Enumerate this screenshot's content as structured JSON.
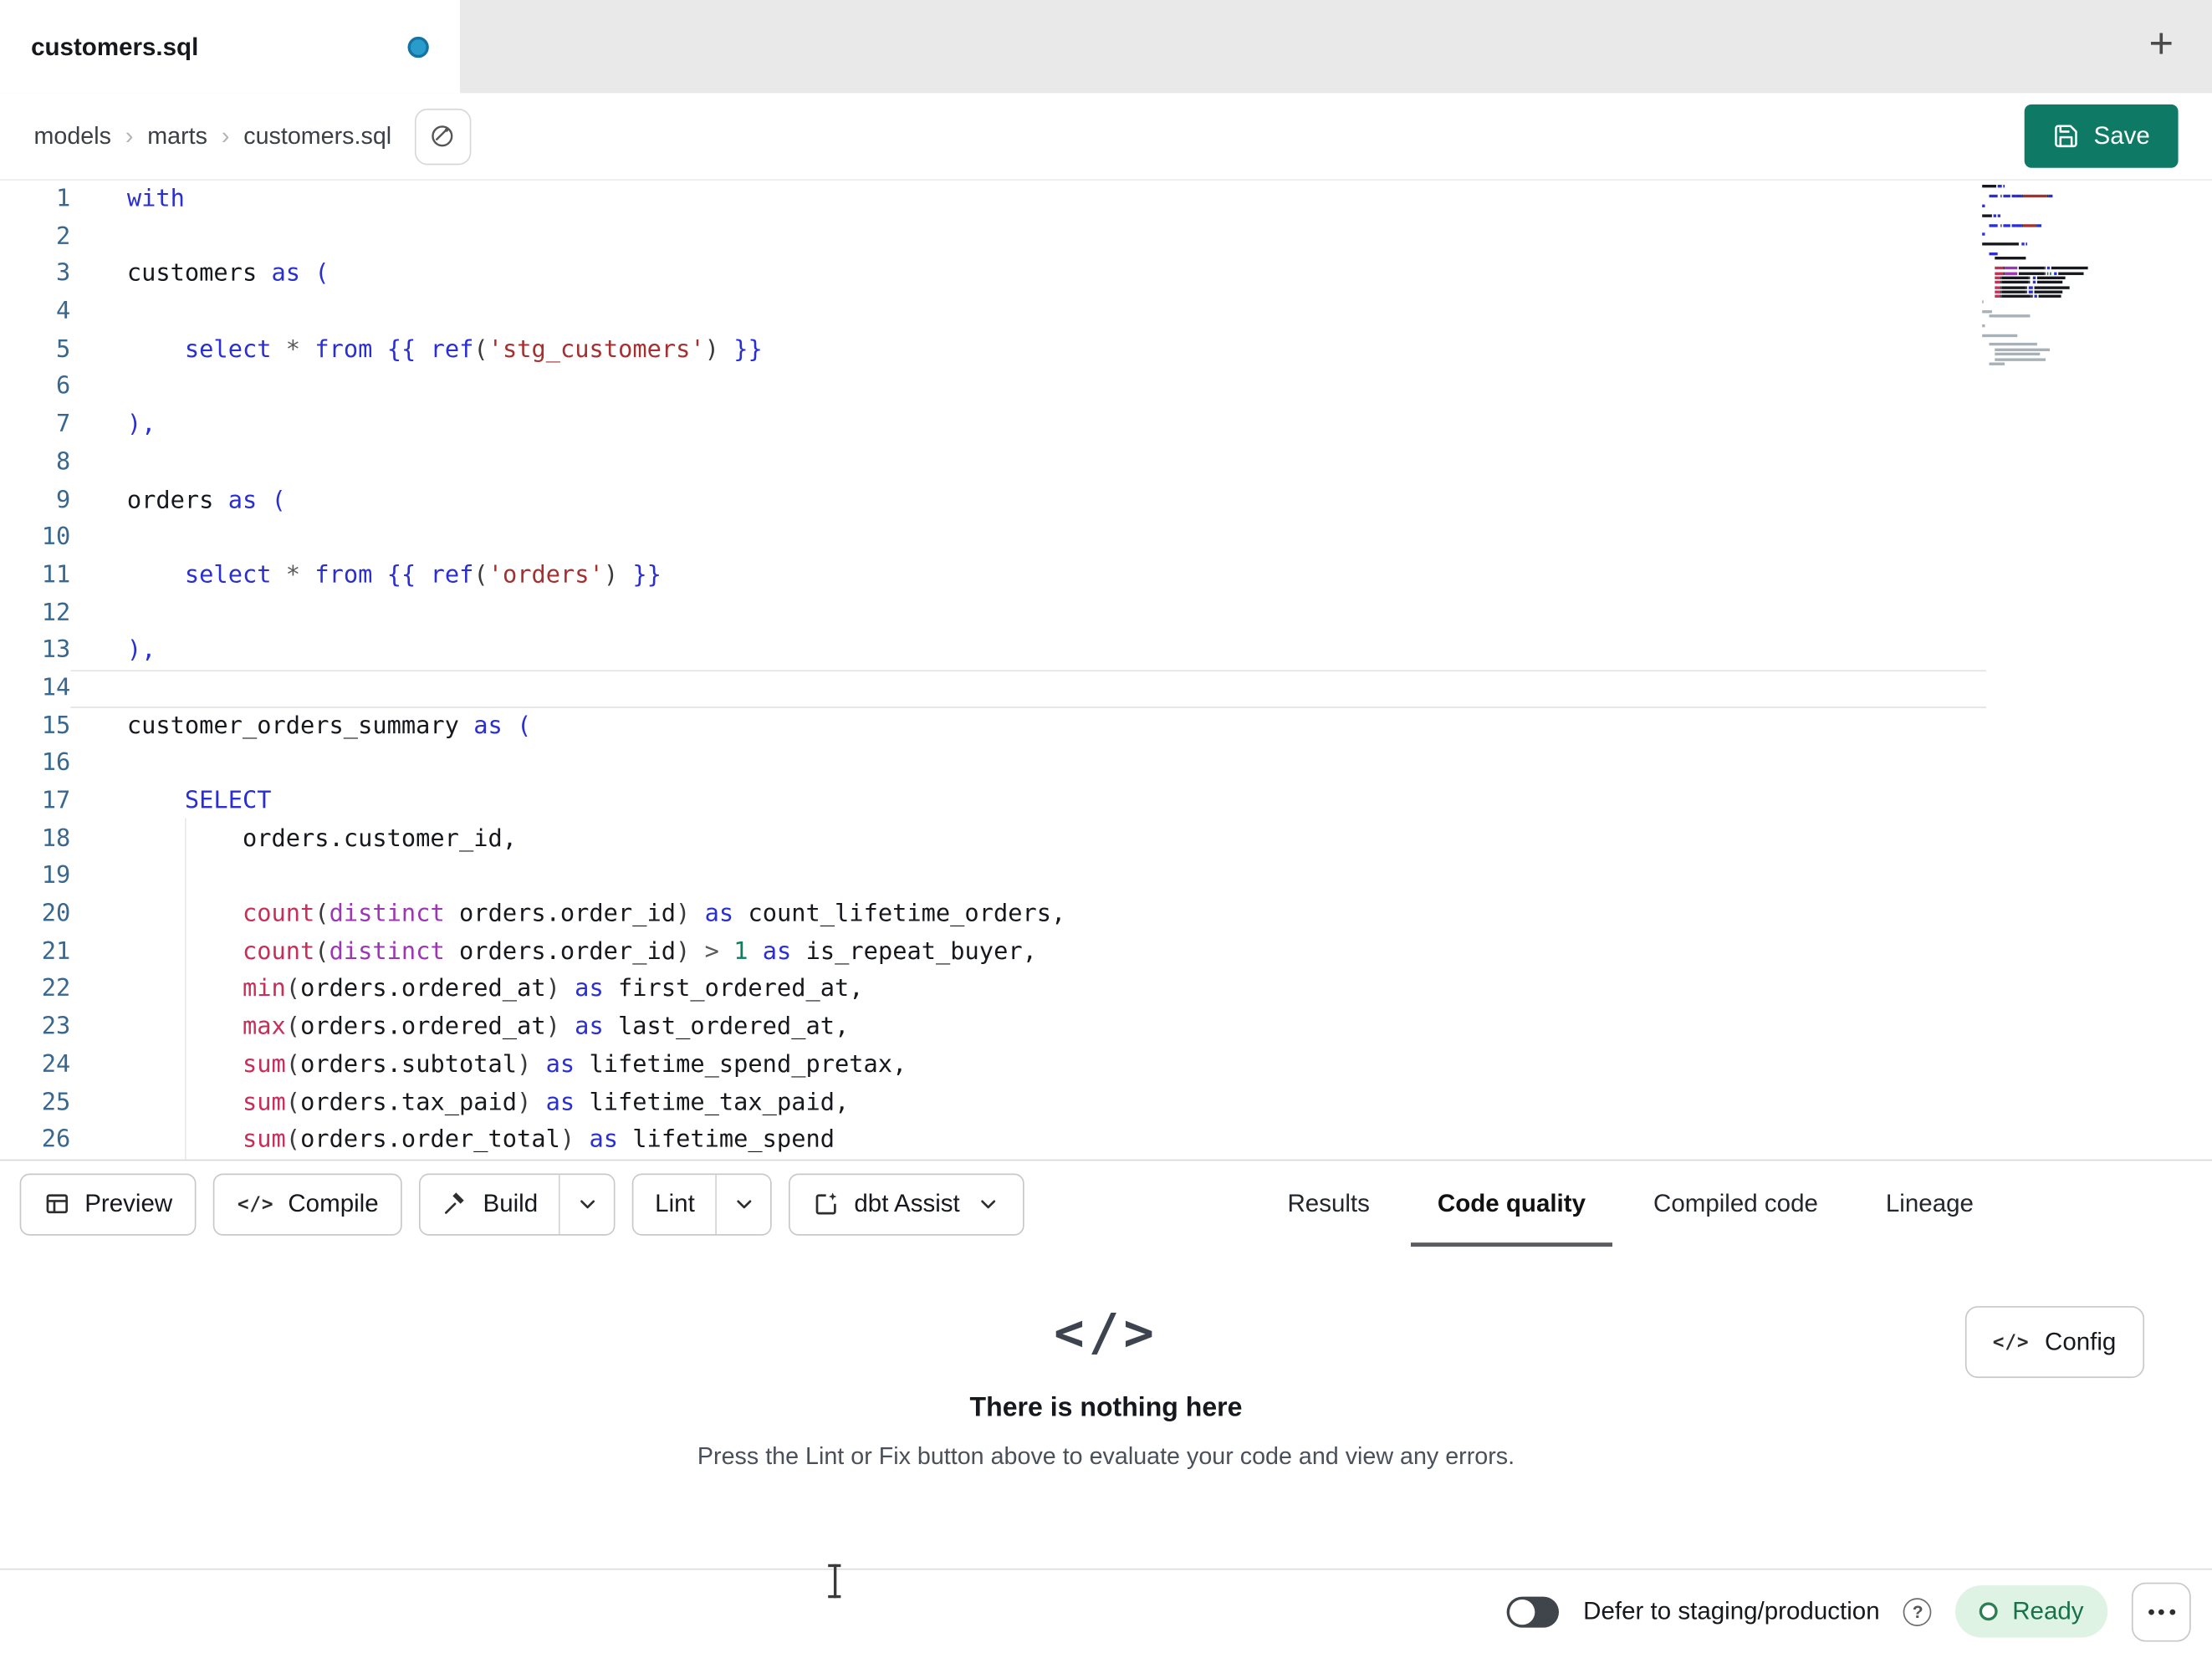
{
  "tabbar": {
    "file_tab": {
      "title": "customers.sql"
    }
  },
  "icons": {
    "code_slash": "</>",
    "new_tab": "+",
    "help": "?",
    "breadcrumb_sep": "›"
  },
  "breadcrumb": {
    "items": [
      "models",
      "marts",
      "customers.sql"
    ]
  },
  "save_button": {
    "label": "Save"
  },
  "editor": {
    "active_line": 14,
    "colors": {
      "kw": "#2a2fd4",
      "fn": "#c72e58",
      "str": "#a53030",
      "dst": "#9c36b5",
      "num": "#0e7d62",
      "op": "#5a5a5a",
      "pu": "#3a3a3a",
      "id": "#16181d"
    },
    "lines": [
      {
        "n": 1,
        "indent": 0,
        "t": [
          [
            "with",
            "kw"
          ]
        ]
      },
      {
        "n": 2,
        "indent": 0,
        "t": []
      },
      {
        "n": 3,
        "indent": 0,
        "t": [
          [
            "customers",
            "id"
          ],
          [
            " ",
            "id"
          ],
          [
            "as",
            "kw"
          ],
          [
            " ",
            "id"
          ],
          [
            "(",
            "kw"
          ]
        ]
      },
      {
        "n": 4,
        "indent": 0,
        "t": []
      },
      {
        "n": 5,
        "indent": 4,
        "t": [
          [
            "select",
            "kw"
          ],
          [
            " ",
            "id"
          ],
          [
            "*",
            "op"
          ],
          [
            " ",
            "id"
          ],
          [
            "from",
            "kw"
          ],
          [
            " ",
            "id"
          ],
          [
            "{{ ",
            "kw"
          ],
          [
            "ref",
            "kw"
          ],
          [
            "(",
            "pu"
          ],
          [
            "'stg_customers'",
            "str"
          ],
          [
            ")",
            "pu"
          ],
          [
            " }}",
            "kw"
          ]
        ]
      },
      {
        "n": 6,
        "indent": 0,
        "t": []
      },
      {
        "n": 7,
        "indent": 0,
        "t": [
          [
            "),",
            "kw"
          ]
        ]
      },
      {
        "n": 8,
        "indent": 0,
        "t": []
      },
      {
        "n": 9,
        "indent": 0,
        "t": [
          [
            "orders",
            "id"
          ],
          [
            " ",
            "id"
          ],
          [
            "as",
            "kw"
          ],
          [
            " ",
            "id"
          ],
          [
            "(",
            "kw"
          ]
        ]
      },
      {
        "n": 10,
        "indent": 0,
        "t": []
      },
      {
        "n": 11,
        "indent": 4,
        "t": [
          [
            "select",
            "kw"
          ],
          [
            " ",
            "id"
          ],
          [
            "*",
            "op"
          ],
          [
            " ",
            "id"
          ],
          [
            "from",
            "kw"
          ],
          [
            " ",
            "id"
          ],
          [
            "{{ ",
            "kw"
          ],
          [
            "ref",
            "kw"
          ],
          [
            "(",
            "pu"
          ],
          [
            "'orders'",
            "str"
          ],
          [
            ")",
            "pu"
          ],
          [
            " }}",
            "kw"
          ]
        ]
      },
      {
        "n": 12,
        "indent": 0,
        "t": []
      },
      {
        "n": 13,
        "indent": 0,
        "t": [
          [
            "),",
            "kw"
          ]
        ]
      },
      {
        "n": 14,
        "indent": 0,
        "t": []
      },
      {
        "n": 15,
        "indent": 0,
        "t": [
          [
            "customer_orders_summary",
            "id"
          ],
          [
            " ",
            "id"
          ],
          [
            "as",
            "kw"
          ],
          [
            " ",
            "id"
          ],
          [
            "(",
            "kw"
          ]
        ]
      },
      {
        "n": 16,
        "indent": 0,
        "t": []
      },
      {
        "n": 17,
        "indent": 4,
        "t": [
          [
            "SELECT",
            "kw"
          ]
        ]
      },
      {
        "n": 18,
        "indent": 8,
        "t": [
          [
            "orders.customer_id,",
            "id"
          ]
        ]
      },
      {
        "n": 19,
        "indent": 0,
        "t": []
      },
      {
        "n": 20,
        "indent": 8,
        "t": [
          [
            "count",
            "fn"
          ],
          [
            "(",
            "pu"
          ],
          [
            "distinct",
            "dst"
          ],
          [
            " ",
            "id"
          ],
          [
            "orders.order_id",
            "id"
          ],
          [
            ")",
            "pu"
          ],
          [
            " ",
            "id"
          ],
          [
            "as",
            "kw"
          ],
          [
            " ",
            "id"
          ],
          [
            "count_lifetime_orders,",
            "id"
          ]
        ]
      },
      {
        "n": 21,
        "indent": 8,
        "t": [
          [
            "count",
            "fn"
          ],
          [
            "(",
            "pu"
          ],
          [
            "distinct",
            "dst"
          ],
          [
            " ",
            "id"
          ],
          [
            "orders.order_id",
            "id"
          ],
          [
            ")",
            "pu"
          ],
          [
            " ",
            "id"
          ],
          [
            ">",
            "op"
          ],
          [
            " ",
            "id"
          ],
          [
            "1",
            "num"
          ],
          [
            " ",
            "id"
          ],
          [
            "as",
            "kw"
          ],
          [
            " ",
            "id"
          ],
          [
            "is_repeat_buyer,",
            "id"
          ]
        ]
      },
      {
        "n": 22,
        "indent": 8,
        "t": [
          [
            "min",
            "fn"
          ],
          [
            "(",
            "pu"
          ],
          [
            "orders.ordered_at",
            "id"
          ],
          [
            ")",
            "pu"
          ],
          [
            " ",
            "id"
          ],
          [
            "as",
            "kw"
          ],
          [
            " ",
            "id"
          ],
          [
            "first_ordered_at,",
            "id"
          ]
        ]
      },
      {
        "n": 23,
        "indent": 8,
        "t": [
          [
            "max",
            "fn"
          ],
          [
            "(",
            "pu"
          ],
          [
            "orders.ordered_at",
            "id"
          ],
          [
            ")",
            "pu"
          ],
          [
            " ",
            "id"
          ],
          [
            "as",
            "kw"
          ],
          [
            " ",
            "id"
          ],
          [
            "last_ordered_at,",
            "id"
          ]
        ]
      },
      {
        "n": 24,
        "indent": 8,
        "t": [
          [
            "sum",
            "fn"
          ],
          [
            "(",
            "pu"
          ],
          [
            "orders.subtotal",
            "id"
          ],
          [
            ")",
            "pu"
          ],
          [
            " ",
            "id"
          ],
          [
            "as",
            "kw"
          ],
          [
            " ",
            "id"
          ],
          [
            "lifetime_spend_pretax,",
            "id"
          ]
        ]
      },
      {
        "n": 25,
        "indent": 8,
        "t": [
          [
            "sum",
            "fn"
          ],
          [
            "(",
            "pu"
          ],
          [
            "orders.tax_paid",
            "id"
          ],
          [
            ")",
            "pu"
          ],
          [
            " ",
            "id"
          ],
          [
            "as",
            "kw"
          ],
          [
            " ",
            "id"
          ],
          [
            "lifetime_tax_paid,",
            "id"
          ]
        ]
      },
      {
        "n": 26,
        "indent": 8,
        "t": [
          [
            "sum",
            "fn"
          ],
          [
            "(",
            "pu"
          ],
          [
            "orders.order_total",
            "id"
          ],
          [
            ")",
            "pu"
          ],
          [
            " ",
            "id"
          ],
          [
            "as",
            "kw"
          ],
          [
            " ",
            "id"
          ],
          [
            "lifetime_spend",
            "id"
          ]
        ]
      }
    ],
    "minimap_tail": [
      [
        0,
        1
      ],
      [
        0,
        0
      ],
      [
        0,
        6
      ],
      [
        4,
        26
      ],
      [
        0,
        0
      ],
      [
        0,
        2
      ],
      [
        0,
        0
      ],
      [
        0,
        22
      ],
      [
        0,
        0
      ],
      [
        4,
        30
      ],
      [
        8,
        34
      ],
      [
        8,
        28
      ],
      [
        8,
        31
      ],
      [
        4,
        10
      ]
    ]
  },
  "toolbar": {
    "buttons": {
      "preview": "Preview",
      "compile": "Compile",
      "build": "Build",
      "lint": "Lint",
      "assist": "dbt Assist"
    },
    "tabs": [
      {
        "label": "Results",
        "active": false
      },
      {
        "label": "Code quality",
        "active": true
      },
      {
        "label": "Compiled code",
        "active": false
      },
      {
        "label": "Lineage",
        "active": false
      }
    ]
  },
  "results_panel": {
    "empty_icon": "</>",
    "title": "There is nothing here",
    "subtitle": "Press the Lint or Fix button above to evaluate your code and view any errors.",
    "config_button": {
      "label": "Config"
    }
  },
  "statusbar": {
    "defer_label": "Defer to staging/production",
    "ready_label": "Ready"
  }
}
